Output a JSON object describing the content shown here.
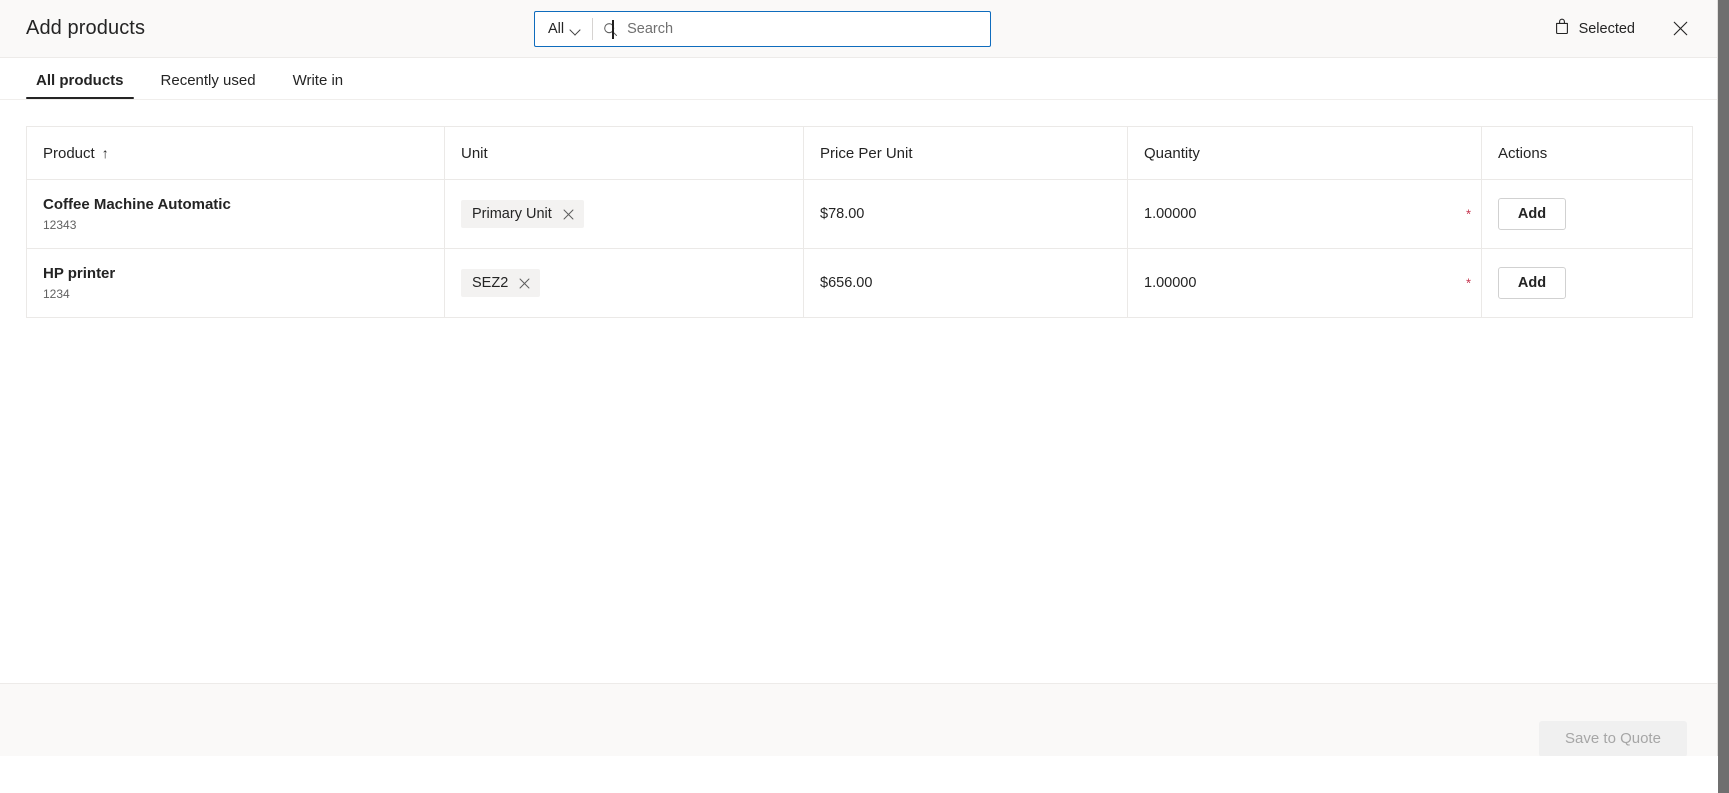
{
  "header": {
    "title": "Add products",
    "search": {
      "scope_label": "All",
      "scope_icon": "chevron-down-icon",
      "search_icon": "search-icon",
      "placeholder": "Search",
      "value": ""
    },
    "selected": {
      "label": "Selected",
      "icon": "shopping-bag-icon"
    },
    "close_icon": "close-icon",
    "accent_color": "#0f6cbd"
  },
  "tabs": [
    {
      "label": "All products",
      "active": true
    },
    {
      "label": "Recently used",
      "active": false
    },
    {
      "label": "Write in",
      "active": false
    }
  ],
  "table": {
    "columns": [
      {
        "label": "Product",
        "sort": "↑"
      },
      {
        "label": "Unit",
        "sort": ""
      },
      {
        "label": "Price Per Unit",
        "sort": ""
      },
      {
        "label": "Quantity",
        "sort": ""
      },
      {
        "label": "Actions",
        "sort": ""
      }
    ],
    "rows": [
      {
        "product_name": "Coffee Machine Automatic",
        "product_code": "12343",
        "unit_chip": "Primary Unit",
        "unit_chip_remove_icon": "close-icon",
        "price_per_unit": "$78.00",
        "quantity": "1.00000",
        "quantity_required_marker": "*",
        "action_label": "Add"
      },
      {
        "product_name": "HP printer",
        "product_code": "1234",
        "unit_chip": "SEZ2",
        "unit_chip_remove_icon": "close-icon",
        "price_per_unit": "$656.00",
        "quantity": "1.00000",
        "quantity_required_marker": "*",
        "action_label": "Add"
      }
    ]
  },
  "footer": {
    "save_label": "Save to Quote",
    "save_disabled": true
  }
}
